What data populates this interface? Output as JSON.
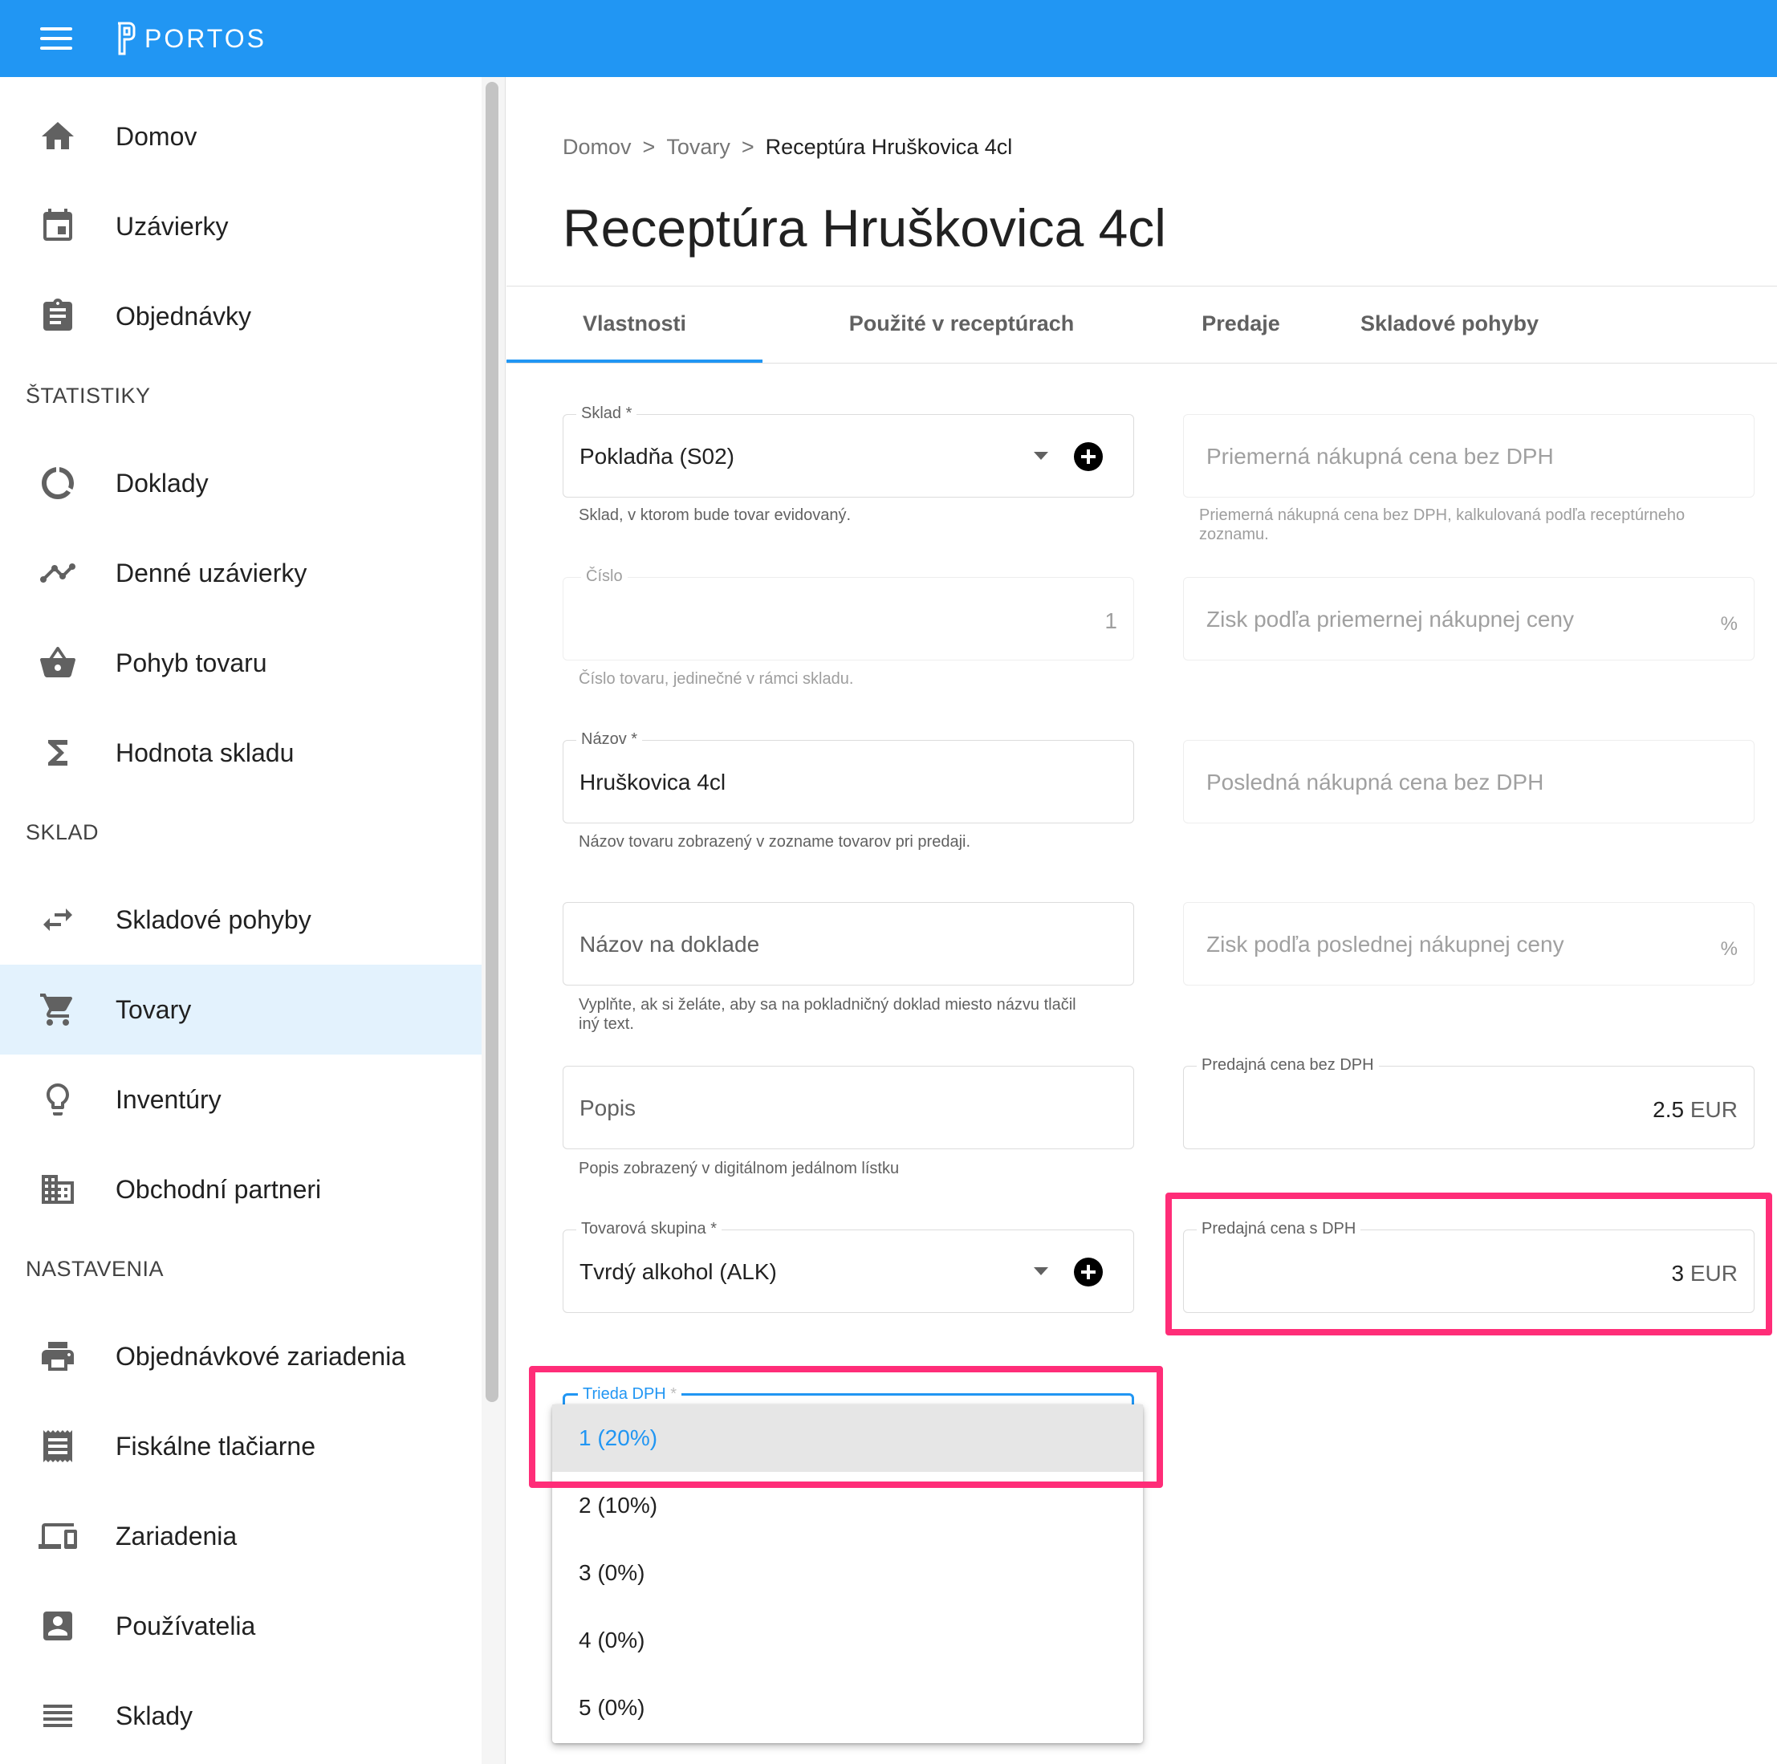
{
  "app": {
    "name": "PORTOS"
  },
  "sidebar": {
    "items_top": [
      {
        "label": "Domov",
        "icon": "home-icon"
      },
      {
        "label": "Uzávierky",
        "icon": "calendar-icon"
      },
      {
        "label": "Objednávky",
        "icon": "clipboard-icon"
      }
    ],
    "section_stats": "ŠTATISTIKY",
    "items_stats": [
      {
        "label": "Doklady",
        "icon": "donut-chart-icon"
      },
      {
        "label": "Denné uzávierky",
        "icon": "trending-icon"
      },
      {
        "label": "Pohyb tovaru",
        "icon": "basket-icon"
      },
      {
        "label": "Hodnota skladu",
        "icon": "sigma-icon"
      }
    ],
    "section_stock": "SKLAD",
    "items_stock": [
      {
        "label": "Skladové pohyby",
        "icon": "swap-arrows-icon"
      },
      {
        "label": "Tovary",
        "icon": "cart-icon",
        "active": true
      },
      {
        "label": "Inventúry",
        "icon": "lightbulb-icon"
      },
      {
        "label": "Obchodní partneri",
        "icon": "building-icon"
      }
    ],
    "section_settings": "NASTAVENIA",
    "items_settings": [
      {
        "label": "Objednávkové zariadenia",
        "icon": "printer-icon"
      },
      {
        "label": "Fiskálne tlačiarne",
        "icon": "receipt-icon"
      },
      {
        "label": "Zariadenia",
        "icon": "devices-icon"
      },
      {
        "label": "Používatelia",
        "icon": "user-icon"
      },
      {
        "label": "Sklady",
        "icon": "warehouse-icon"
      }
    ]
  },
  "breadcrumb": {
    "home": "Domov",
    "sep": ">",
    "goods": "Tovary",
    "current": "Receptúra Hruškovica 4cl"
  },
  "page": {
    "title": "Receptúra Hruškovica 4cl"
  },
  "tabs": [
    "Vlastnosti",
    "Použité v receptúrach",
    "Predaje",
    "Skladové pohyby"
  ],
  "form": {
    "sklad": {
      "label": "Sklad *",
      "value": "Pokladňa (S02)",
      "hint": "Sklad, v ktorom bude tovar evidovaný."
    },
    "cislo": {
      "label": "Číslo",
      "value": "1",
      "hint": "Číslo tovaru, jedinečné v rámci skladu."
    },
    "nazov": {
      "label": "Názov *",
      "value": "Hruškovica 4cl",
      "hint": "Názov tovaru zobrazený v zozname tovarov pri predaji."
    },
    "nazov_doklad": {
      "placeholder": "Názov na doklade",
      "hint_line1": "Vyplňte, ak si želáte, aby sa na pokladničný doklad miesto názvu tlačil",
      "hint_line2": "iný text."
    },
    "popis": {
      "placeholder": "Popis",
      "hint": "Popis zobrazený v digitálnom jedálnom lístku"
    },
    "tovarova_skupina": {
      "label": "Tovarová skupina *",
      "value": "Tvrdý alkohol (ALK)"
    },
    "trieda_dph": {
      "label": "Trieda DPH",
      "required_mark": "*"
    },
    "priemerna_cena": {
      "placeholder": "Priemerná nákupná cena bez DPH",
      "hint_line1": "Priemerná nákupná cena bez DPH, kalkulovaná podľa receptúrneho",
      "hint_line2": "zoznamu."
    },
    "zisk_priemerna": {
      "placeholder": "Zisk podľa priemernej nákupnej ceny",
      "suffix": "%"
    },
    "posledna_cena": {
      "placeholder": "Posledná nákupná cena bez DPH"
    },
    "zisk_posledna": {
      "placeholder": "Zisk podľa poslednej nákupnej ceny",
      "suffix": "%"
    },
    "predajna_bez": {
      "label": "Predajná cena bez DPH",
      "value": "2.5",
      "unit": "EUR"
    },
    "predajna_s": {
      "label": "Predajná cena s DPH",
      "value": "3",
      "unit": "EUR"
    }
  },
  "vat_options": [
    "1 (20%)",
    "2 (10%)",
    "3 (0%)",
    "4 (0%)",
    "5 (0%)"
  ],
  "colors": {
    "primary": "#2196f3",
    "highlight": "#ff2d78",
    "active_nav": "#e3f2fd"
  }
}
